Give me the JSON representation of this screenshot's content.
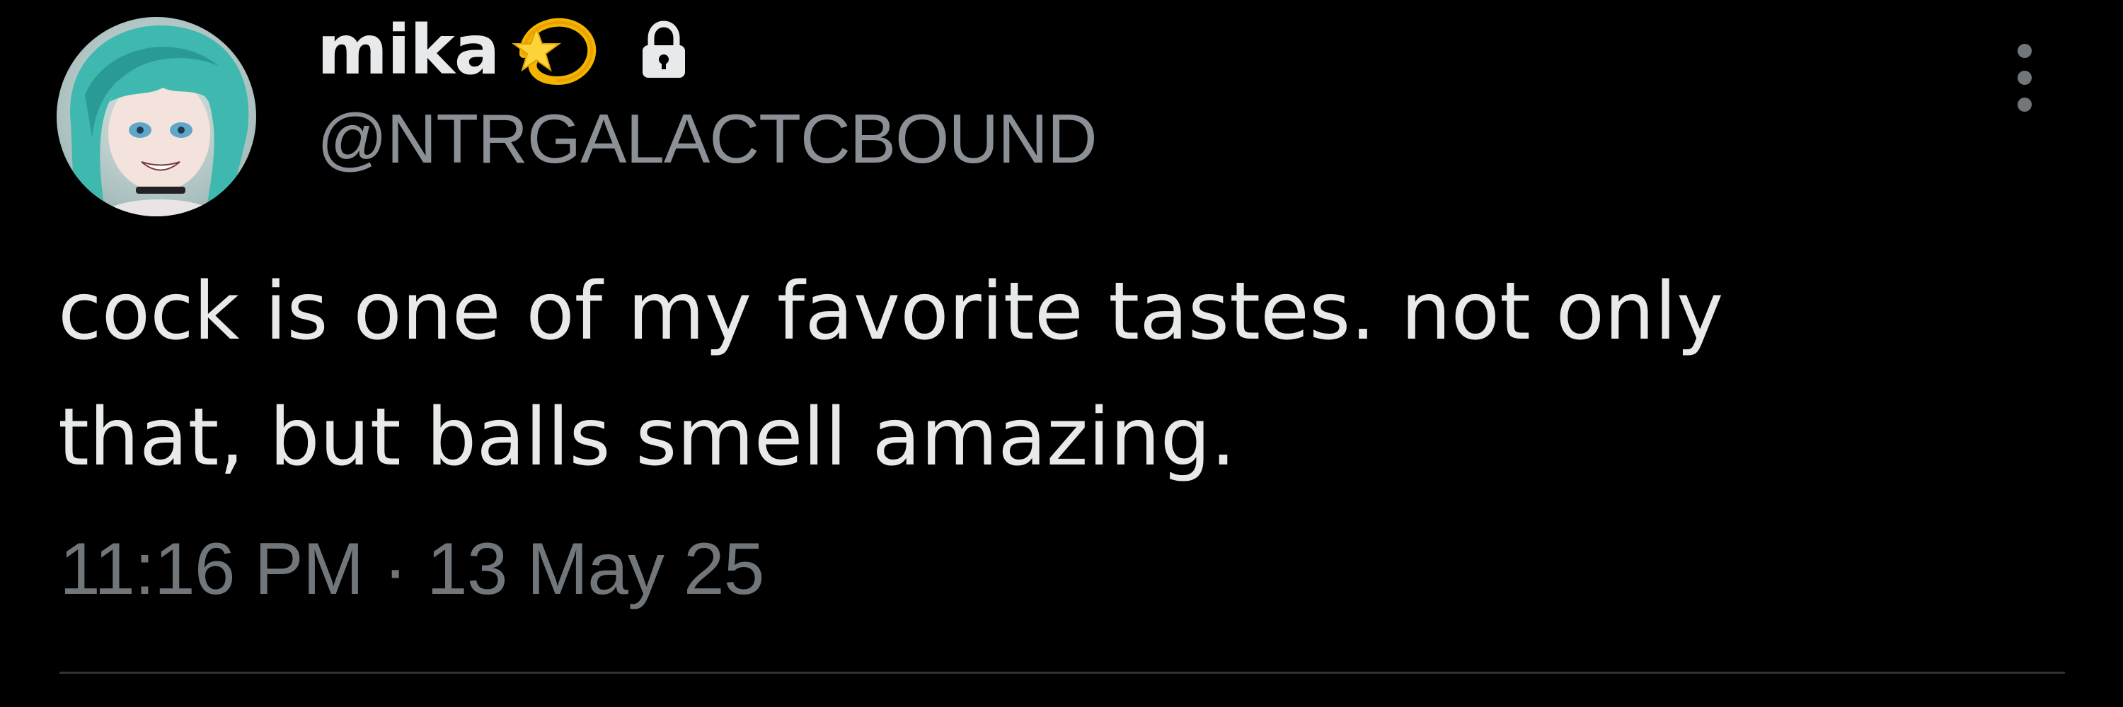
{
  "user": {
    "display_name": "mika",
    "handle": "@NTRGALACTCBOUND",
    "name_emoji_icon": "dizzy-star-icon",
    "protected_icon": "lock-icon"
  },
  "tweet": {
    "text_line1": "cock is one of my favorite tastes. not only",
    "text_line2": "that, but balls smell amazing.",
    "time": "11:16 PM",
    "separator": "·",
    "date": "13 May 25"
  },
  "menu": {
    "icon": "more-options-icon"
  },
  "colors": {
    "background": "#000000",
    "primary_text": "#e7e9ea",
    "secondary_text": "#71767b",
    "divider": "#2f3336",
    "avatar_hair": "#3fb8b0",
    "emoji_gold": "#f4b400"
  }
}
